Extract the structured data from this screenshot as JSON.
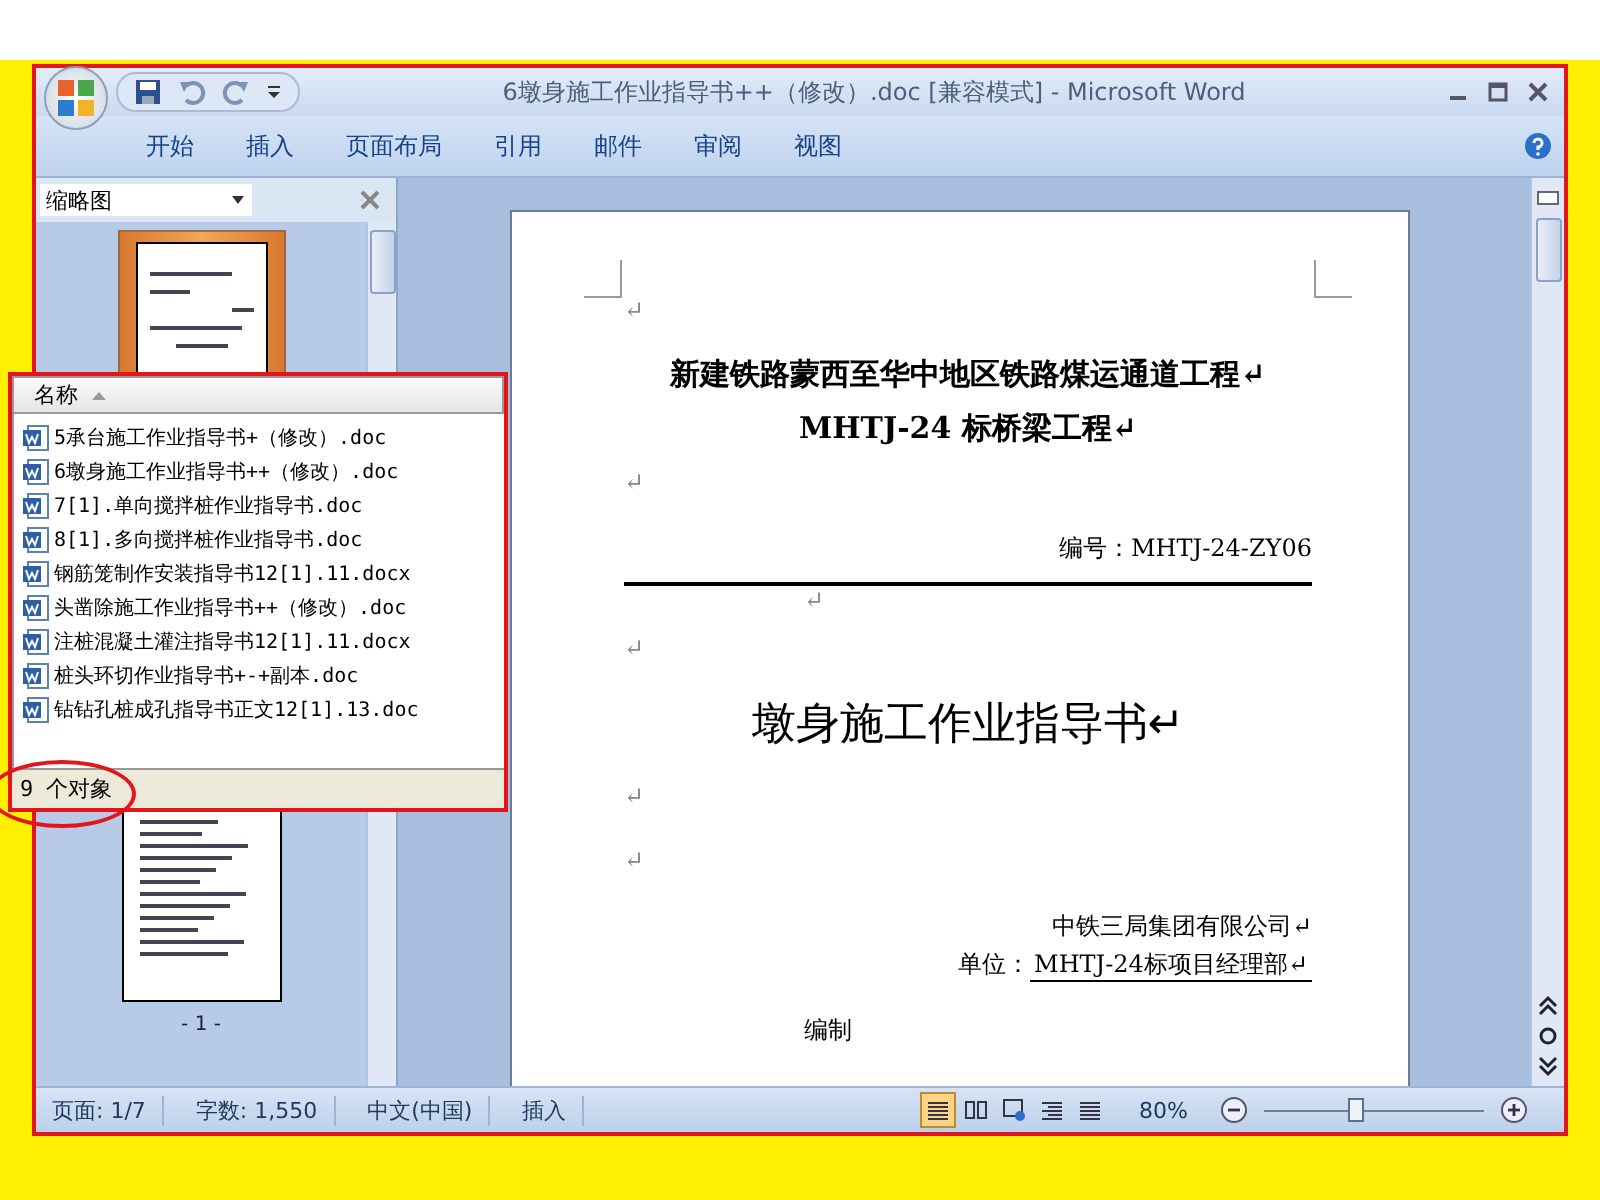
{
  "window": {
    "title": "6墩身施工作业指导书++（修改）.doc [兼容模式] - Microsoft Word"
  },
  "ribbon_tabs": [
    "开始",
    "插入",
    "页面布局",
    "引用",
    "邮件",
    "审阅",
    "视图"
  ],
  "thumbnail_pane": {
    "title": "缩略图",
    "page_label": "- 1 -"
  },
  "document": {
    "paragraphs": [
      {
        "kind": "empty",
        "text": "↵"
      },
      {
        "kind": "title",
        "text": "新建铁路蒙西至华中地区铁路煤运通道工程↵"
      },
      {
        "kind": "title",
        "text": "MHTJ-24 标桥梁工程↵"
      },
      {
        "kind": "empty",
        "text": "↵"
      },
      {
        "kind": "right",
        "text": "编号：MHTJ-24-ZY06"
      },
      {
        "kind": "rule",
        "text": "↵"
      },
      {
        "kind": "empty",
        "text": "↵"
      },
      {
        "kind": "heading",
        "text": "墩身施工作业指导书↵"
      },
      {
        "kind": "empty",
        "text": "↵"
      },
      {
        "kind": "empty",
        "text": "↵"
      },
      {
        "kind": "right",
        "text": "中铁三局集团有限公司↵"
      },
      {
        "kind": "unit",
        "label": "单位：",
        "text": "MHTJ-24标项目经理部↵"
      },
      {
        "kind": "cut",
        "text": "编制"
      }
    ]
  },
  "file_list": {
    "column": "名称",
    "sort_ascending": true,
    "files": [
      "5承台施工作业指导书+（修改）.doc",
      "6墩身施工作业指导书++（修改）.doc",
      "7[1].单向搅拌桩作业指导书.doc",
      "8[1].多向搅拌桩作业指导书.doc",
      "钢筋笼制作安装指导书12[1].11.docx",
      "头凿除施工作业指导书++（修改）.doc",
      "注桩混凝土灌注指导书12[1].11.docx",
      "桩头环切作业指导书+-+副本.doc",
      "钻钻孔桩成孔指导书正文12[1].13.doc"
    ],
    "status": "9 个对象"
  },
  "status_bar": {
    "page": "页面: 1/7",
    "words": "字数: 1,550",
    "language": "中文(中国)",
    "mode": "插入",
    "views": [
      {
        "selected": true
      },
      {
        "selected": false
      },
      {
        "selected": false
      },
      {
        "selected": false
      },
      {
        "selected": false
      }
    ],
    "zoom": "80%",
    "zoom_slider": {
      "level": 0.42
    }
  }
}
